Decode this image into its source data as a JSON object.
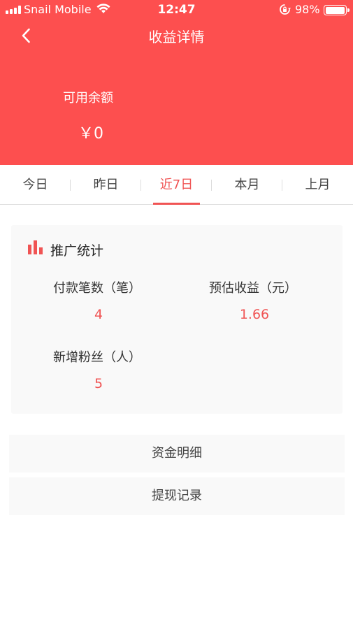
{
  "status_bar": {
    "carrier": "Snail Mobile",
    "time": "12:47",
    "battery_percent": "98%",
    "icons": [
      "signal-icon",
      "wifi-icon",
      "orientation-lock-icon",
      "battery-icon"
    ]
  },
  "header": {
    "title": "收益详情",
    "back_icon": "chevron-left-icon",
    "balance_label": "可用余额",
    "balance_value": "￥0"
  },
  "tabs": {
    "items": [
      {
        "label": "今日"
      },
      {
        "label": "昨日"
      },
      {
        "label": "近7日"
      },
      {
        "label": "本月"
      },
      {
        "label": "上月"
      }
    ],
    "active": "近7日"
  },
  "stats": {
    "icon": "bar-chart-icon",
    "title": "推广统计",
    "payment_count_label": "付款笔数（笔）",
    "payment_count_value": "4",
    "estimated_income_label": "预估收益（元）",
    "estimated_income_value": "1.66",
    "new_fans_label": "新增粉丝（人）",
    "new_fans_value": "5"
  },
  "links": {
    "fund_details": "资金明细",
    "withdraw_records": "提现记录"
  },
  "colors": {
    "header_bg": "#fd4f4f",
    "accent": "#f05454",
    "card_bg": "#f9f9f9"
  }
}
